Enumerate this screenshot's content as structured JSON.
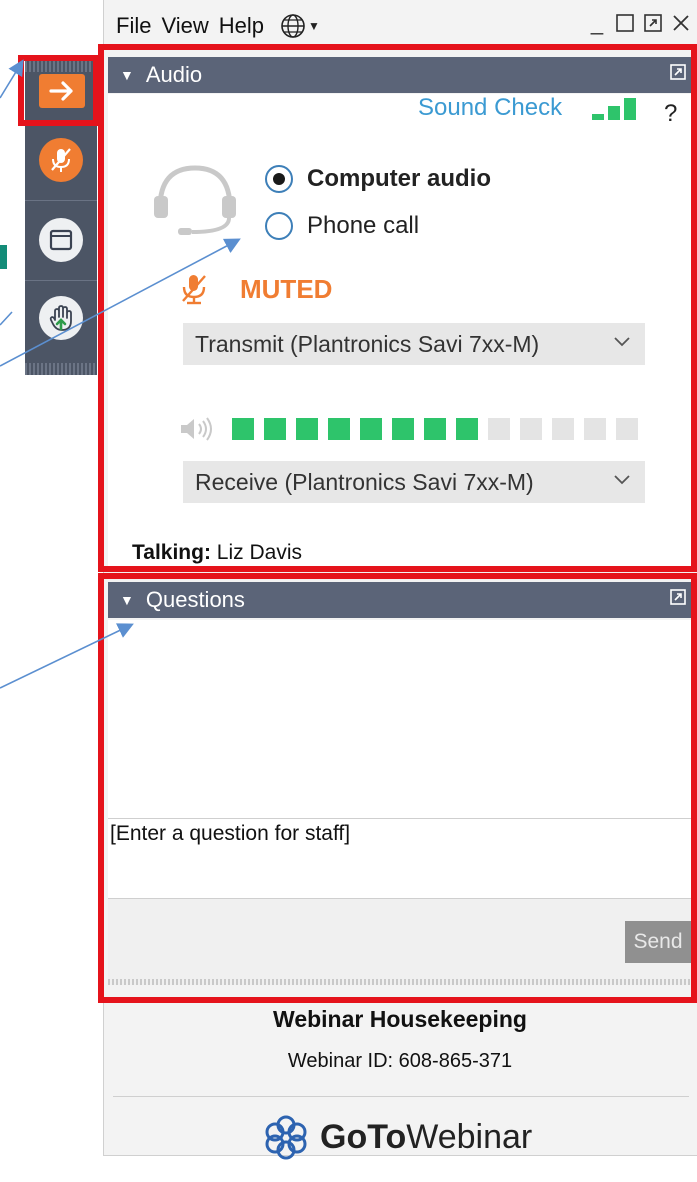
{
  "menu": {
    "file": "File",
    "view": "View",
    "help": "Help"
  },
  "window_controls": {
    "minimize": "_"
  },
  "audio": {
    "header": "Audio",
    "sound_check": "Sound Check",
    "help": "?",
    "options": [
      {
        "label": "Computer audio",
        "selected": true
      },
      {
        "label": "Phone call",
        "selected": false
      }
    ],
    "status": "MUTED",
    "transmit_device": "Transmit (Plantronics Savi 7xx-M)",
    "receive_device": "Receive (Plantronics Savi 7xx-M)",
    "volume_level": {
      "filled": 8,
      "total": 13
    },
    "talking_label": "Talking:",
    "talking_name": "Liz Davis"
  },
  "questions": {
    "header": "Questions",
    "input_placeholder": "[Enter a question for staff]",
    "send_label": "Send"
  },
  "footer": {
    "title": "Webinar Housekeeping",
    "webinar_id": "Webinar ID: 608-865-371",
    "brand_go": "GoTo",
    "brand_webinar": "Webinar"
  },
  "colors": {
    "accent_orange": "#f07d32",
    "highlight_red": "#e5131b",
    "header_bg": "#5b6478",
    "link_blue": "#3b9ad2",
    "meter_green": "#2ec46b"
  }
}
